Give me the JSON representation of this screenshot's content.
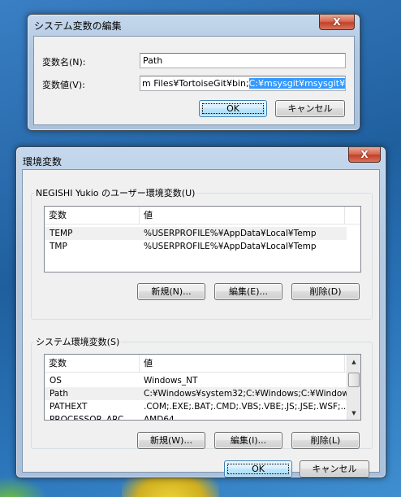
{
  "edit_dialog": {
    "title": "システム変数の編集",
    "close_glyph": "X",
    "var_name_label": "変数名(N):",
    "var_name_value": "Path",
    "var_value_label": "変数値(V):",
    "var_value_text": "m Files¥TortoiseGit¥bin;",
    "var_value_selected": "C:¥msysgit¥msysgit¥bin",
    "ok_label": "OK",
    "cancel_label": "キャンセル"
  },
  "env_dialog": {
    "title": "環境変数",
    "close_glyph": "X",
    "user_group_title": "NEGISHI Yukio のユーザー環境変数(U)",
    "user_columns": [
      "変数",
      "値"
    ],
    "user_rows": [
      {
        "name": "TEMP",
        "value": "%USERPROFILE%¥AppData¥Local¥Temp"
      },
      {
        "name": "TMP",
        "value": "%USERPROFILE%¥AppData¥Local¥Temp"
      }
    ],
    "user_buttons": {
      "new": "新規(N)...",
      "edit": "編集(E)...",
      "delete": "削除(D)"
    },
    "system_group_title": "システム環境変数(S)",
    "system_columns": [
      "変数",
      "値"
    ],
    "system_rows": [
      {
        "name": "OS",
        "value": "Windows_NT"
      },
      {
        "name": "Path",
        "value": "C:¥Windows¥system32;C:¥Windows;C:¥Window..."
      },
      {
        "name": "PATHEXT",
        "value": ".COM;.EXE;.BAT;.CMD;.VBS;.VBE;.JS;.JSE;.WSF;..."
      },
      {
        "name": "PROCESSOR_ARC...",
        "value": "AMD64"
      }
    ],
    "system_buttons": {
      "new": "新規(W)...",
      "edit": "編集(I)...",
      "delete": "削除(L)"
    },
    "ok_label": "OK",
    "cancel_label": "キャンセル"
  }
}
